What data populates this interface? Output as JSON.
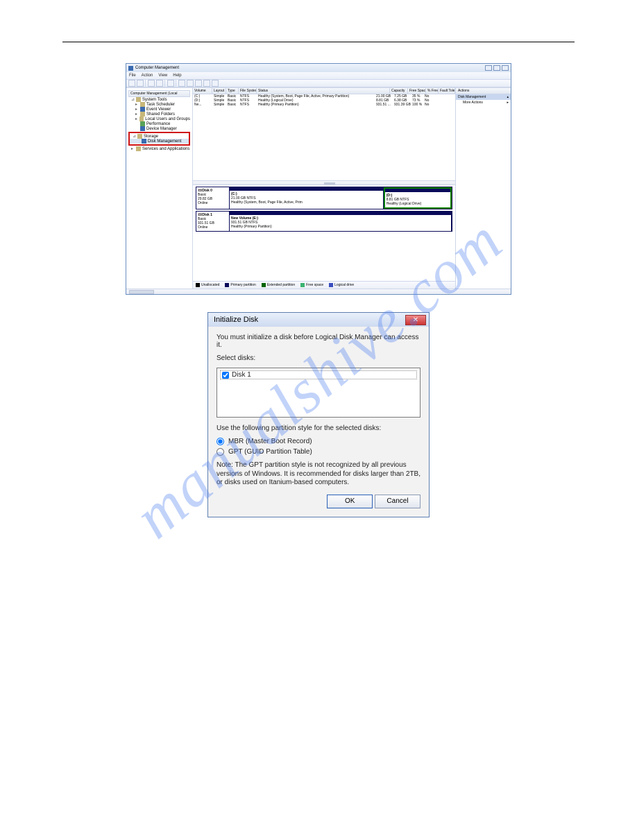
{
  "cm": {
    "title": "Computer Management",
    "menus": [
      "File",
      "Action",
      "View",
      "Help"
    ],
    "tree": {
      "root": "Computer Management (Local",
      "sections": [
        {
          "label": "System Tools",
          "items": [
            "Task Scheduler",
            "Event Viewer",
            "Shared Folders",
            "Local Users and Groups",
            "Performance",
            "Device Manager"
          ]
        },
        {
          "label": "Storage",
          "items": [
            "Disk Management"
          ]
        },
        {
          "label": "Services and Applications",
          "items": []
        }
      ]
    },
    "columns": {
      "vol": "Volume",
      "lay": "Layout",
      "typ": "Type",
      "fs": "File System",
      "stat": "Status",
      "cap": "Capacity",
      "free": "Free Space",
      "pct": "% Free",
      "ft": "Fault Tole"
    },
    "volumes": [
      {
        "name": "(C:)",
        "layout": "Simple",
        "type": "Basic",
        "fs": "NTFS",
        "status": "Healthy (System, Boot, Page File, Active, Primary Partition)",
        "cap": "21.00 GB",
        "free": "7.25 GB",
        "pct": "35 %",
        "ft": "No"
      },
      {
        "name": "(D:)",
        "layout": "Simple",
        "type": "Basic",
        "fs": "NTFS",
        "status": "Healthy (Logical Drive)",
        "cap": "8.81 GB",
        "free": "6.38 GB",
        "pct": "73 %",
        "ft": "No"
      },
      {
        "name": "Ne...",
        "layout": "Simple",
        "type": "Basic",
        "fs": "NTFS",
        "status": "Healthy (Primary Partition)",
        "cap": "931.51 ...",
        "free": "931.39 GB",
        "pct": "100 %",
        "ft": "No"
      }
    ],
    "disks": [
      {
        "label": "Disk 0",
        "type": "Basic",
        "size": "29.82 GB",
        "state": "Online",
        "parts": [
          {
            "name": "(C:)",
            "detail": "21.00 GB NTFS",
            "status": "Healthy (System, Boot, Page File, Active, Prim",
            "sel": false
          },
          {
            "name": "(D:)",
            "detail": "8.81 GB NTFS",
            "status": "Healthy (Logical Drive)",
            "sel": true
          }
        ]
      },
      {
        "label": "Disk 1",
        "type": "Basic",
        "size": "931.51 GB",
        "state": "Online",
        "parts": [
          {
            "name": "New Volume (E:)",
            "detail": "931.51 GB NTFS",
            "status": "Healthy (Primary Partition)",
            "sel": false
          }
        ]
      }
    ],
    "legend": [
      {
        "label": "Unallocated",
        "color": "#000000"
      },
      {
        "label": "Primary partition",
        "color": "#0a0a5a"
      },
      {
        "label": "Extended partition",
        "color": "#006400"
      },
      {
        "label": "Free space",
        "color": "#3cb371"
      },
      {
        "label": "Logical drive",
        "color": "#3a4fbf"
      }
    ],
    "actions": {
      "header": "Actions",
      "group": "Disk Management",
      "item": "More Actions"
    }
  },
  "dlg": {
    "title": "Initialize Disk",
    "message": "You must initialize a disk before Logical Disk Manager can access it.",
    "selectLabel": "Select disks:",
    "diskName": "Disk 1",
    "partLabel": "Use the following partition style for the selected disks:",
    "radios": {
      "mbr": "MBR (Master Boot Record)",
      "gpt": "GPT (GUID Partition Table)"
    },
    "note": "Note: The GPT partition style is not recognized by all previous versions of Windows. It is recommended for disks larger than 2TB, or disks used on Itanium-based computers.",
    "ok": "OK",
    "cancel": "Cancel"
  },
  "watermark": "manualshive.com"
}
